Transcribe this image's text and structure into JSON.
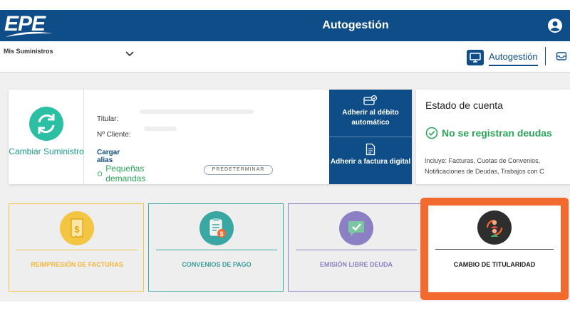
{
  "header": {
    "logo": "EPE",
    "title": "Autogestión"
  },
  "subbar": {
    "suministros_label": "Mis Suministros",
    "autogestion_tab": "Autogestión"
  },
  "supply_card": {
    "change_label": "Cambiar Suministro",
    "titular_label": "Titular:",
    "cliente_label": "Nº Cliente:",
    "alias_link": "Cargar alias",
    "demand_type": "Pequeñas demandas",
    "predeterminar_button": "PREDETERMINAR",
    "debit_button": "Adherir al débito automático",
    "digital_button": "Adherir a factura digital"
  },
  "account_card": {
    "title": "Estado de cuenta",
    "status": "No se registran deudas",
    "includes_line1": "Incluye: Facturas, Cuotas de Convenios,",
    "includes_line2": "Notificaciones de Deudas, Trabajos con C"
  },
  "tiles": [
    {
      "label": "REIMPRESIÓN DE FACTURAS",
      "icon": "invoice-dollar-icon"
    },
    {
      "label": "CONVENIOS DE PAGO",
      "icon": "clipboard-coin-icon"
    },
    {
      "label": "EMISIÓN LIBRE DEUDA",
      "icon": "message-check-icon"
    },
    {
      "label": "CAMBIO DE TITULARIDAD",
      "icon": "people-exchange-icon"
    }
  ],
  "colors": {
    "brand_blue": "#0e4d87",
    "teal": "#2bbfa4",
    "green": "#2aa55a",
    "highlight_orange": "#f26a2d",
    "tile_yellow": "#f4c542",
    "tile_teal": "#3aa7a3",
    "tile_purple": "#8c7fc4"
  }
}
